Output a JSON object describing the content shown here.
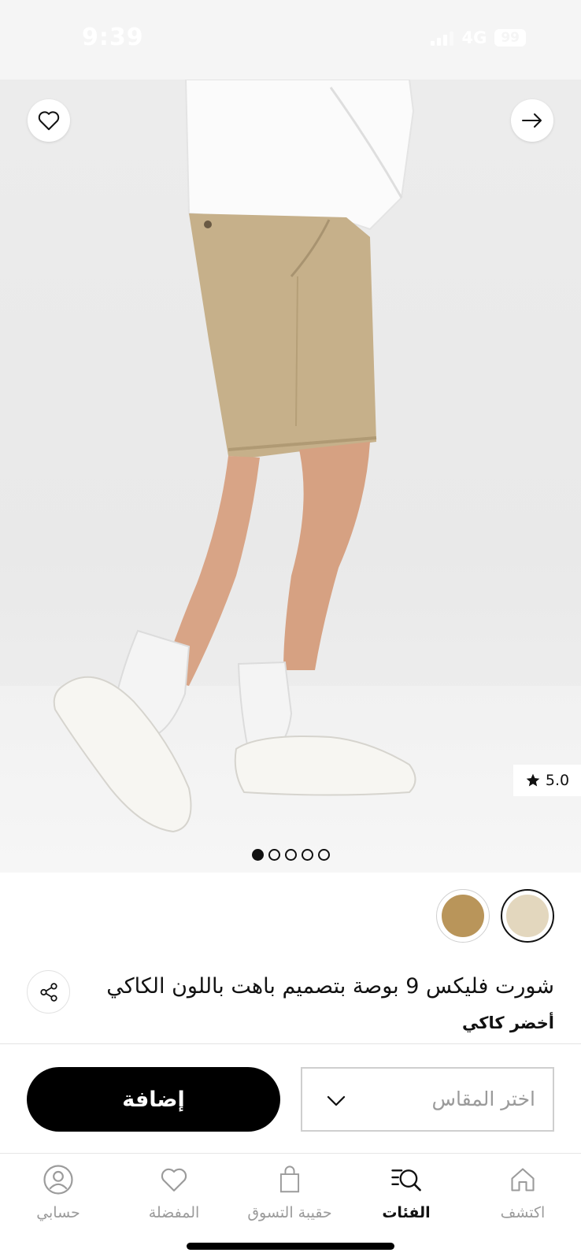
{
  "status_bar": {
    "time": "9:39",
    "network": "4G",
    "battery": "99"
  },
  "product": {
    "title": "شورت فليكس 9 بوصة بتصميم باهت باللون الكاكي",
    "color_name": "أخضر كاكي",
    "rating": "5.0",
    "image_count": 5,
    "active_image": 1,
    "swatches": [
      {
        "name": "khaki-light",
        "color": "#e3d7be",
        "selected": true
      },
      {
        "name": "khaki-tan",
        "color": "#b9955a",
        "selected": false
      }
    ]
  },
  "actions": {
    "add_label": "إضافة",
    "size_placeholder": "اختر المقاس"
  },
  "tabs": [
    {
      "label": "اكتشف",
      "icon": "home-icon",
      "active": false
    },
    {
      "label": "الفئات",
      "icon": "categories-search-icon",
      "active": true
    },
    {
      "label": "حقيبة التسوق",
      "icon": "shopping-bag-icon",
      "active": false
    },
    {
      "label": "المفضلة",
      "icon": "heart-icon",
      "active": false
    },
    {
      "label": "حسابي",
      "icon": "user-icon",
      "active": false
    }
  ],
  "colors": {
    "accent": "#000000",
    "inactive": "#9b9b9b",
    "skin": "#d8a486",
    "shorts": "#c6b08a"
  }
}
